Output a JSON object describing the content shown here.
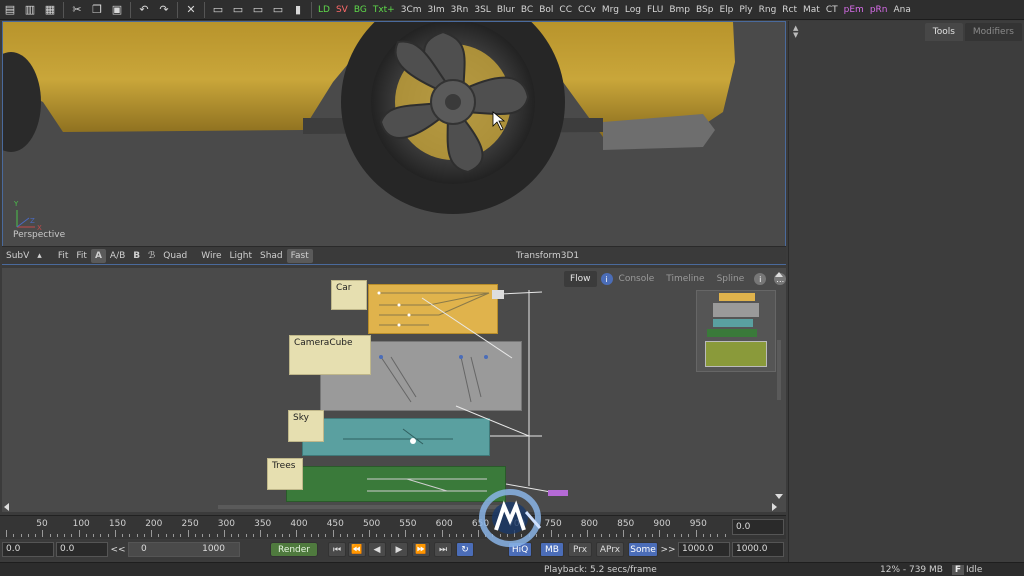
{
  "toolbar": {
    "icons": [
      "new-file-icon",
      "open-icon",
      "save-icon",
      "cut-icon",
      "copy-icon",
      "paste-icon",
      "undo-icon",
      "redo-icon",
      "tools-icon",
      "layout-1-icon",
      "layout-2-icon",
      "layout-3-icon",
      "layout-4-icon",
      "script-icon"
    ],
    "tools": [
      "LD",
      "SV",
      "BG",
      "Txt+",
      "3Cm",
      "3Im",
      "3Rn",
      "3SL",
      "Blur",
      "BC",
      "Bol",
      "CC",
      "CCv",
      "Mrg",
      "Log",
      "FLU",
      "Bmp",
      "BSp",
      "Elp",
      "Ply",
      "Rng",
      "Rct",
      "Mat",
      "CT",
      "pEm",
      "pRn",
      "Ana"
    ]
  },
  "viewer": {
    "perspective_label": "Perspective",
    "axis_labels": {
      "x": "X",
      "y": "Y",
      "z": "Z"
    },
    "title": "Transform3D1",
    "buttons": {
      "subv": "SubV",
      "fit": "Fit",
      "fit2": "Fit",
      "a": "A",
      "ab": "A/B",
      "b": "B",
      "quad": "Quad",
      "wire": "Wire",
      "light": "Light",
      "shad": "Shad",
      "fast": "Fast"
    }
  },
  "right_panel": {
    "tabs": [
      "Tools",
      "Modifiers"
    ]
  },
  "flow": {
    "tabs": [
      "Flow",
      "Console",
      "Timeline",
      "Spline"
    ],
    "groups": [
      {
        "title": "Car",
        "color": "#e0b34c"
      },
      {
        "title": "CameraCube",
        "color": "#9a9a9a"
      },
      {
        "title": "Sky",
        "color": "#5aa0a0"
      },
      {
        "title": "Trees",
        "color": "#3a7a3a"
      }
    ]
  },
  "timeline": {
    "ticks": [
      "0",
      "50",
      "100",
      "150",
      "200",
      "250",
      "300",
      "350",
      "400",
      "450",
      "500",
      "550",
      "600",
      "650",
      "700",
      "750",
      "800",
      "850",
      "900",
      "950"
    ],
    "current_time": "0.0",
    "global_start": "0.0",
    "render_start": "0.0",
    "range_prefix": "<<",
    "range_start": "0",
    "range_end": "1000",
    "render_label": "Render",
    "hiq_label": "HiQ",
    "mb_label": "MB",
    "prx_label": "Prx",
    "aprx_label": "APrx",
    "some_label": "Some",
    "range_suffix": ">>",
    "render_end": "1000.0",
    "global_end": "1000.0"
  },
  "status": {
    "playback": "Playback: 5.2 secs/frame",
    "memory": "12% - 739 MB",
    "state": "Idle"
  }
}
